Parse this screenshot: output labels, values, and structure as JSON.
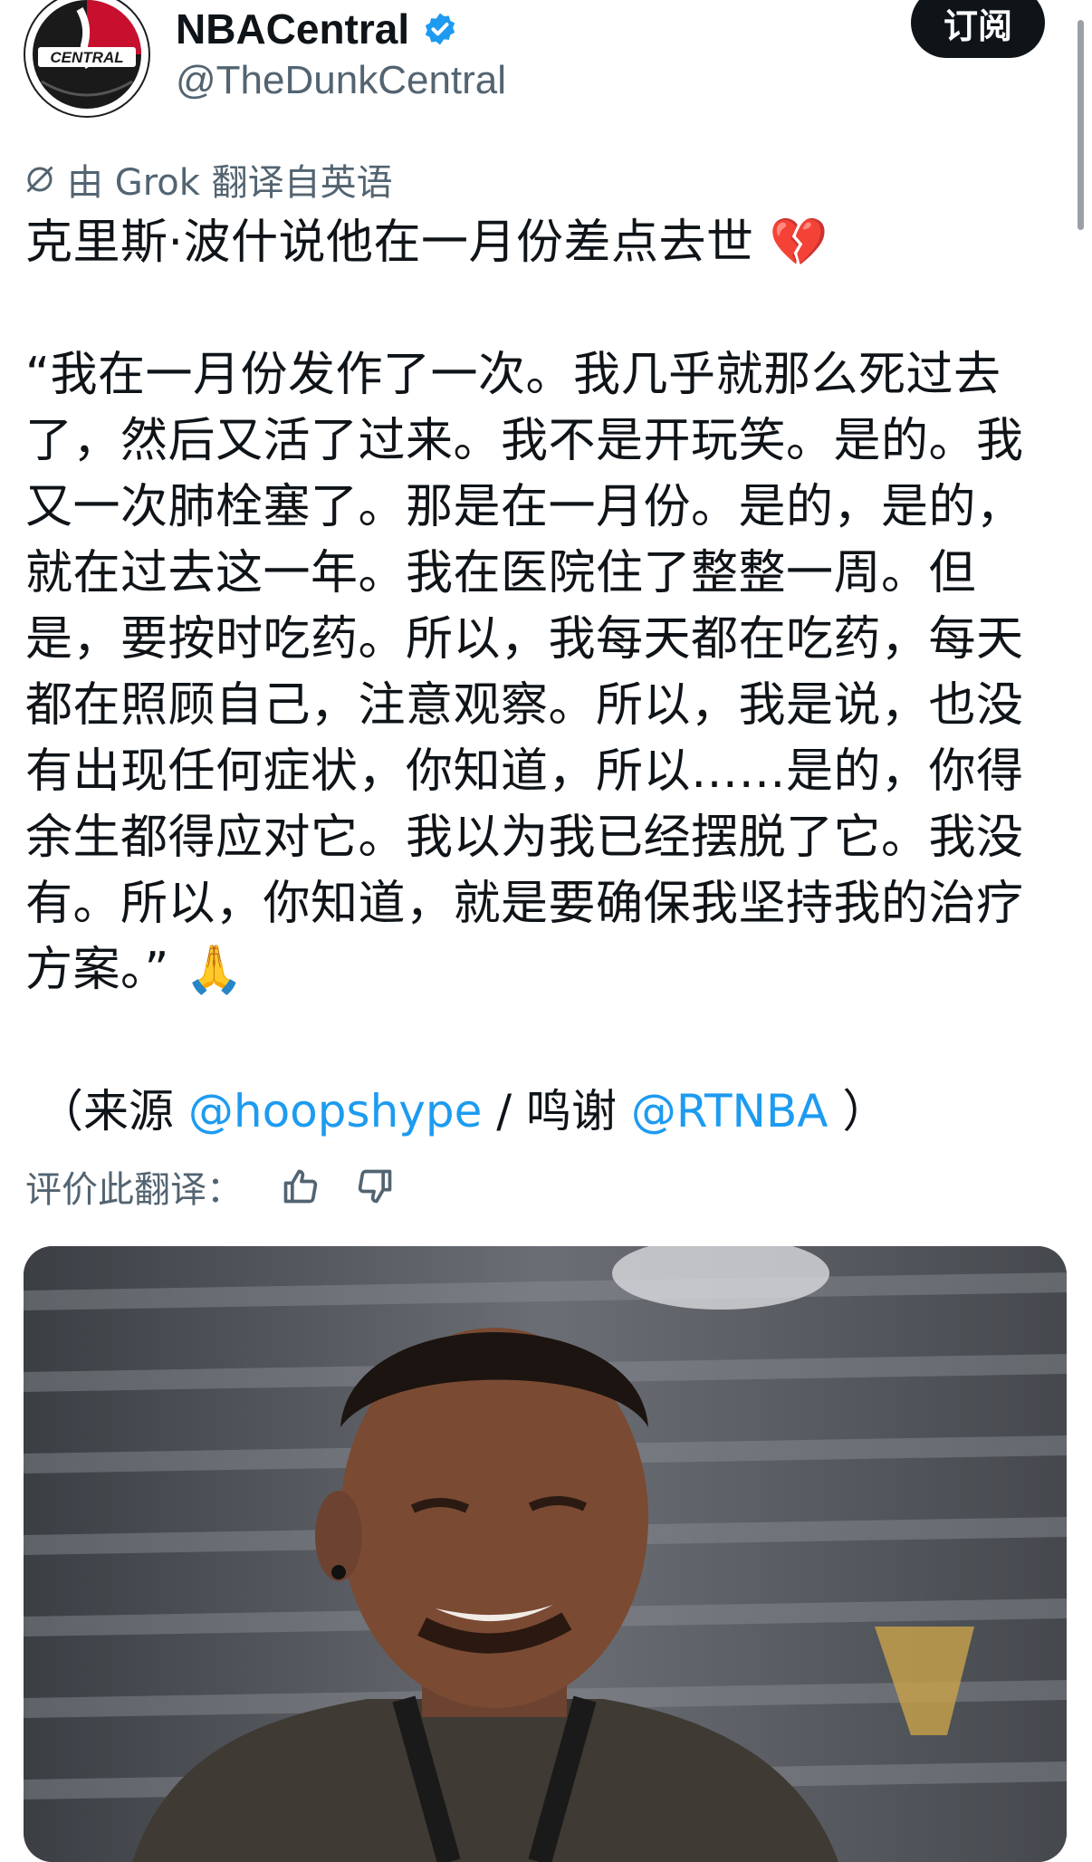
{
  "author": {
    "display_name": "NBACentral",
    "handle": "@TheDunkCentral",
    "avatar_logo": "CENTRAL",
    "verified_icon": "verified-badge-icon"
  },
  "subscribe_label": "订阅",
  "translation_note": "由 Grok 翻译自英语",
  "tweet": {
    "headline": "克里斯·波什说他在一月份差点去世",
    "headline_emoji": "💔",
    "quote": "“我在一月份发作了一次。我几乎就那么死过去了，然后又活了过来。我不是开玩笑。是的。我又一次肺栓塞了。那是在一月份。是的，是的，就在过去这一年。我在医院住了整整一周。但是，要按时吃药。所以，我每天都在吃药，每天都在照顾自己，注意观察。所以，我是说，也没有出现任何症状，你知道，所以……是的，你得余生都得应对它。我以为我已经摆脱了它。我没有。所以，你知道，就是要确保我坚持我的治疗方案。”",
    "quote_emoji": "🙏"
  },
  "source": {
    "open": "（来源 ",
    "source_link": "@hoopshype",
    "sep": " / 鸣谢 ",
    "credit_link": "@RTNBA",
    "close": " ）"
  },
  "rate": {
    "label": "评价此翻译：",
    "up_icon": "thumbs-up-icon",
    "down_icon": "thumbs-down-icon"
  },
  "colors": {
    "text": "#0f1419",
    "secondary": "#536471",
    "link": "#1d9bf0",
    "verified": "#1d9bf0",
    "button": "#0f1419"
  }
}
